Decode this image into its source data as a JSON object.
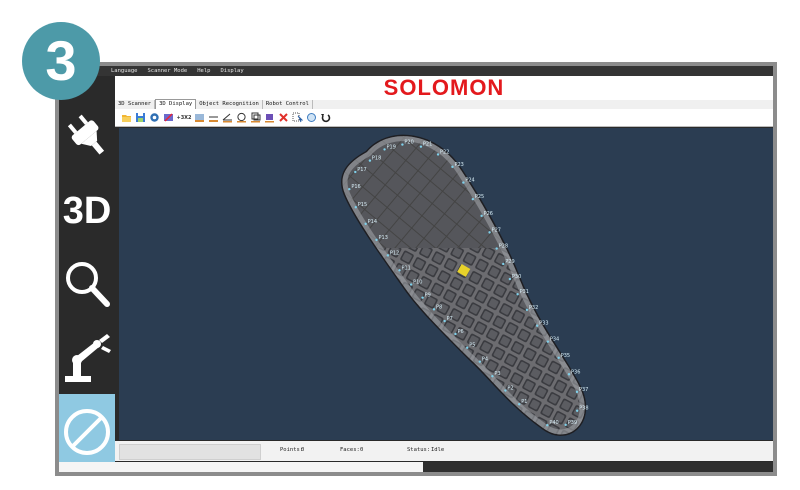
{
  "step_badge": "3",
  "menu": [
    "Language",
    "Scanner Mode",
    "Help",
    "Display"
  ],
  "brand": "SOLOMON",
  "sidebar": {
    "items": [
      {
        "name": "plug-icon"
      },
      {
        "name": "3d-mode",
        "label": "3D"
      },
      {
        "name": "magnifier-icon"
      },
      {
        "name": "robot-arm-icon"
      },
      {
        "name": "no-entry-icon",
        "active": true
      }
    ]
  },
  "tabs": [
    {
      "label": "3D Scanner",
      "active": false
    },
    {
      "label": "3D Display",
      "active": true
    },
    {
      "label": "Object Recognition",
      "active": false
    },
    {
      "label": "Robot Control",
      "active": false
    }
  ],
  "toolbar": {
    "icons": [
      "folder-open-icon",
      "save-icon",
      "settings-icon",
      "tools-icon",
      "1x2-icon",
      "grid-icon",
      "measure-line-icon",
      "angle-icon",
      "clock-icon",
      "copy-icon",
      "color-icon",
      "delete-icon",
      "select-icon",
      "rotate-view-icon",
      "undo-icon"
    ],
    "zoom_label": "+3X2"
  },
  "viewport": {
    "points": [
      "P1",
      "P2",
      "P3",
      "P4",
      "P5",
      "P6",
      "P7",
      "P8",
      "P9",
      "P10",
      "P11",
      "P12",
      "P13",
      "P14",
      "P15",
      "P16",
      "P17",
      "P18",
      "P19",
      "P20",
      "P21",
      "P22",
      "P23",
      "P24",
      "P25",
      "P26",
      "P27",
      "P28",
      "P29",
      "P30",
      "P31",
      "P32",
      "P33",
      "P34",
      "P35",
      "P36",
      "P37",
      "P38",
      "P39",
      "P40"
    ]
  },
  "status": {
    "points_label": "Points:",
    "points_value": "0",
    "faces_label": "Faces:",
    "faces_value": "0",
    "status_label": "Status:",
    "status_value": "Idle"
  }
}
